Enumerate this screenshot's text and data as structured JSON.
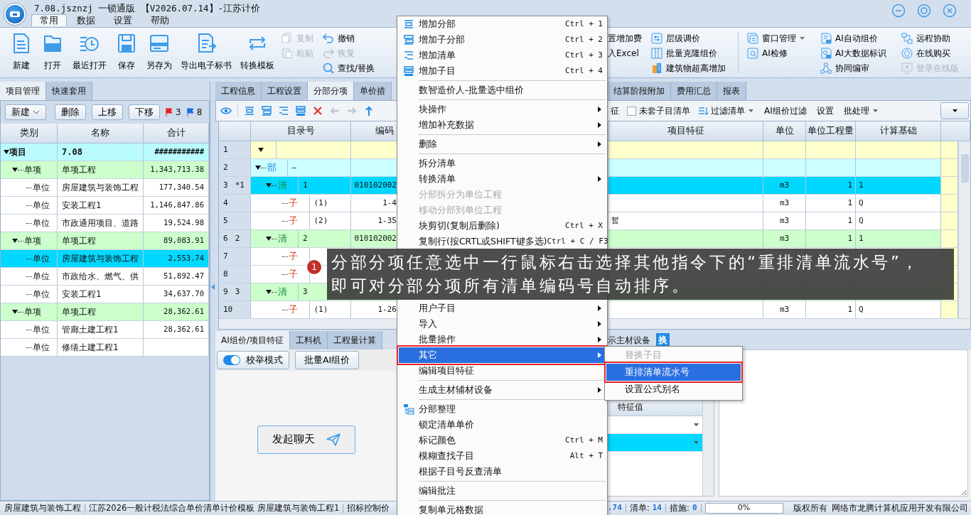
{
  "window": {
    "title": "7.08.jsznzj 一锁通版 【V2026.07.14】-江苏计价"
  },
  "ribbon_tabs": [
    {
      "label": "常用",
      "selected": true
    },
    {
      "label": "数据",
      "selected": false
    },
    {
      "label": "设置",
      "selected": false
    },
    {
      "label": "帮助",
      "selected": false
    }
  ],
  "ribbon_large": [
    "新建",
    "打开",
    "最近打开",
    "保存",
    "另存为",
    "导出电子标书",
    "转换模板"
  ],
  "ribbon_small_left": [
    [
      {
        "label": "复制",
        "kind": "button",
        "disabled": true
      },
      {
        "label": "粘贴",
        "kind": "button",
        "disabled": true
      }
    ],
    [
      {
        "label": "撤销",
        "kind": "button",
        "disabled": false
      },
      {
        "label": "恢复",
        "kind": "button",
        "disabled": true
      },
      {
        "label": "查找/替换",
        "kind": "button",
        "disabled": false
      }
    ]
  ],
  "ribbon_small_right": [
    [
      {
        "label": "置增加费",
        "kind": "plain",
        "disabled": false
      },
      {
        "label": "入Excel",
        "kind": "plain",
        "disabled": false
      }
    ],
    [
      {
        "label": "层级调价",
        "kind": "button",
        "disabled": false
      },
      {
        "label": "批量克隆组价",
        "kind": "button",
        "disabled": false
      },
      {
        "label": "建筑物超高增加",
        "kind": "button",
        "disabled": false
      }
    ],
    [
      {
        "label": "窗口管理",
        "kind": "menu",
        "disabled": false
      },
      {
        "label": "AI检修",
        "kind": "button",
        "disabled": false
      }
    ],
    [
      {
        "label": "AI自动组价",
        "kind": "button",
        "disabled": false
      },
      {
        "label": "AI大数据标识",
        "kind": "button",
        "disabled": false
      },
      {
        "label": "协同编审",
        "kind": "button",
        "disabled": false
      }
    ],
    [
      {
        "label": "远程协助",
        "kind": "button",
        "disabled": false
      },
      {
        "label": "在线购买",
        "kind": "button",
        "disabled": false
      },
      {
        "label": "登录在线版",
        "kind": "button",
        "disabled": true
      }
    ]
  ],
  "left_panel": {
    "tabs": [
      {
        "label": "项目管理",
        "selected": true
      },
      {
        "label": "快速套用",
        "selected": false
      }
    ],
    "toolbar": [
      {
        "label": "新建",
        "kind": "menu"
      },
      {
        "label": "删除",
        "kind": "button"
      },
      {
        "label": "上移",
        "kind": "button"
      },
      {
        "label": "下移",
        "kind": "button"
      }
    ],
    "flags": [
      {
        "count": "3",
        "color": "#e8201a"
      },
      {
        "count": "8",
        "color": "#1a6fe0"
      }
    ],
    "columns": [
      "类别",
      "名称",
      "合计"
    ],
    "tree": [
      {
        "type": "项目",
        "name": "7.08",
        "total": "###########",
        "kind": "project",
        "expanded": true,
        "selected": false,
        "children": [
          {
            "type": "单项",
            "name": "单项工程",
            "total": "1,343,713.38",
            "kind": "single",
            "expanded": true,
            "selected": false,
            "children": [
              {
                "type": "单位",
                "name": "房屋建筑与装饰工程",
                "total": "177,340.54",
                "kind": "unit",
                "selected": false
              },
              {
                "type": "单位",
                "name": "安装工程1",
                "total": "1,146,847.86",
                "kind": "unit",
                "selected": false
              },
              {
                "type": "单位",
                "name": "市政通用项目、道路",
                "total": "19,524.98",
                "kind": "unit",
                "selected": false
              }
            ]
          },
          {
            "type": "单项",
            "name": "单项工程",
            "total": "89,083.91",
            "kind": "single",
            "expanded": true,
            "selected": false,
            "children": [
              {
                "type": "单位",
                "name": "房屋建筑与装饰工程",
                "total": "2,553.74",
                "kind": "unit",
                "selected": true
              },
              {
                "type": "单位",
                "name": "市政给水、燃气、供",
                "total": "51,892.47",
                "kind": "unit",
                "selected": false
              },
              {
                "type": "单位",
                "name": "安装工程1",
                "total": "34,637.70",
                "kind": "unit",
                "selected": false
              }
            ]
          },
          {
            "type": "单项",
            "name": "单项工程",
            "total": "28,362.61",
            "kind": "single",
            "expanded": true,
            "selected": false,
            "children": [
              {
                "type": "单位",
                "name": "管廊土建工程1",
                "total": "28,362.61",
                "kind": "unit",
                "selected": false
              },
              {
                "type": "单位",
                "name": "修缮土建工程1",
                "kind": "unit",
                "selected": false
              }
            ]
          }
        ]
      }
    ]
  },
  "main_tabs_left": [
    {
      "label": "工程信息",
      "selected": false
    },
    {
      "label": "工程设置",
      "selected": false
    },
    {
      "label": "分部分项",
      "selected": true
    },
    {
      "label": "单价措",
      "selected": false
    }
  ],
  "main_tabs_right": [
    {
      "label": "结算阶段附加",
      "selected": false
    },
    {
      "label": "费用汇总",
      "selected": false
    },
    {
      "label": "报表",
      "selected": false
    }
  ],
  "grid_toolbar": {
    "tools": [
      {
        "disabled": false
      },
      {
        "disabled": false
      },
      {
        "disabled": false
      },
      {
        "disabled": false
      },
      {
        "disabled": false
      },
      {
        "disabled": false
      },
      {
        "disabled": true
      },
      {
        "disabled": true
      },
      {
        "disabled": false
      }
    ],
    "right": [
      {
        "kind": "text",
        "label": "征"
      },
      {
        "kind": "checkbox",
        "label": "未套子目清单",
        "checked": false
      },
      {
        "kind": "menu",
        "label": "过滤清单"
      },
      {
        "kind": "text",
        "label": "AI组价过滤"
      },
      {
        "kind": "text",
        "label": "设置"
      },
      {
        "kind": "menu",
        "label": "批处理"
      }
    ]
  },
  "grid": {
    "columns_left": [
      "目录号",
      "编码"
    ],
    "columns_right": [
      "项目特征",
      "单位",
      "单位工程量",
      "计算基础"
    ],
    "rows": [
      {
        "num": "1",
        "kind": "root",
        "expanded": true,
        "selected": false,
        "children": [
          {
            "num": "2",
            "kind": "division",
            "tag": "部",
            "catalog": "—",
            "expanded": true,
            "selected": false,
            "children": [
              {
                "num": "3",
                "seq": "*1",
                "kind": "item",
                "tag": "清",
                "catalog": "1",
                "code": "010102002",
                "unit": "m3",
                "qty": "1",
                "base": "1",
                "expanded": true,
                "selected": true,
                "children": [
                  {
                    "num": "4",
                    "kind": "sub",
                    "tag": "子",
                    "catalog": "(1)",
                    "code": "1-4",
                    "unit": "m3",
                    "qty": "1",
                    "base": "Q",
                    "selected": false
                  },
                  {
                    "num": "5",
                    "kind": "sub",
                    "tag": "子",
                    "catalog": "(2)",
                    "code": "1-35",
                    "feature": "暂",
                    "unit": "m3",
                    "qty": "1",
                    "base": "Q",
                    "selected": false
                  }
                ]
              },
              {
                "num": "6",
                "seq": "2",
                "kind": "item",
                "tag": "清",
                "catalog": "2",
                "code": "010102002",
                "unit": "m3",
                "qty": "1",
                "base": "1",
                "expanded": true,
                "selected": false,
                "children": [
                  {
                    "num": "7",
                    "kind": "sub",
                    "tag": "子",
                    "selected": false
                  },
                  {
                    "num": "8",
                    "kind": "sub",
                    "tag": "子",
                    "selected": false
                  }
                ]
              },
              {
                "num": "9",
                "seq": "3",
                "kind": "item",
                "tag": "清",
                "catalog": "3",
                "expanded": true,
                "selected": false,
                "children": [
                  {
                    "num": "10",
                    "kind": "sub",
                    "tag": "子",
                    "catalog": "(1)",
                    "code": "1-26",
                    "unit": "m3",
                    "qty": "1",
                    "base": "Q",
                    "selected": false
                  }
                ]
              }
            ]
          }
        ]
      }
    ]
  },
  "bottom_tabs": [
    {
      "label": "AI组价/项目特征",
      "selected": true
    },
    {
      "label": "工料机",
      "selected": false
    },
    {
      "label": "工程量计算",
      "selected": false
    }
  ],
  "bottom_right_tab": {
    "label": "示主材设备",
    "badge": "换"
  },
  "ai_panel": {
    "toggle": {
      "label": "校举模式",
      "on": true
    },
    "batch_button": "批量AI组价",
    "chat_button": "发起聊天"
  },
  "feature_table": {
    "column": "特征值",
    "rows": [
      {
        "selected": false
      },
      {
        "selected": true
      }
    ]
  },
  "context_menu": [
    {
      "kind": "icon-action",
      "label": "增加分部",
      "shortcut": "Ctrl + 1",
      "disabled": false,
      "selected": false
    },
    {
      "kind": "icon-action",
      "label": "增加子分部",
      "shortcut": "Ctrl + 2",
      "disabled": false,
      "selected": false
    },
    {
      "kind": "icon-action",
      "label": "增加清单",
      "shortcut": "Ctrl + 3",
      "disabled": false,
      "selected": false
    },
    {
      "kind": "icon-action",
      "label": "增加子目",
      "shortcut": "Ctrl + 4",
      "disabled": false,
      "selected": false
    },
    {
      "kind": "separator"
    },
    {
      "kind": "action",
      "label": "数智造价人-批量选中组价",
      "disabled": false,
      "selected": false
    },
    {
      "kind": "separator"
    },
    {
      "kind": "submenu",
      "label": "块操作",
      "disabled": false,
      "selected": false
    },
    {
      "kind": "submenu",
      "label": "增加补充数据",
      "disabled": false,
      "selected": false
    },
    {
      "kind": "separator"
    },
    {
      "kind": "submenu",
      "label": "删除",
      "disabled": false,
      "selected": false
    },
    {
      "kind": "separator"
    },
    {
      "kind": "action",
      "label": "拆分清单",
      "disabled": false,
      "selected": false
    },
    {
      "kind": "submenu",
      "label": "转换清单",
      "disabled": false,
      "selected": false
    },
    {
      "kind": "action",
      "label": "分部拆分为单位工程",
      "disabled": true,
      "selected": false
    },
    {
      "kind": "action",
      "label": "移动分部到单位工程",
      "disabled": true,
      "selected": false
    },
    {
      "kind": "action",
      "label": "块剪切(复制后删除)",
      "shortcut": "Ctrl + X",
      "disabled": false,
      "selected": false
    },
    {
      "kind": "action",
      "label": "复制行(按CRTL或SHIFT键多选)",
      "shortcut": "Ctrl + C / F3",
      "disabled": false,
      "selected": false
    },
    {
      "kind": "covered"
    },
    {
      "kind": "covered"
    },
    {
      "kind": "covered"
    },
    {
      "kind": "submenu",
      "label": "用户子目",
      "disabled": false,
      "selected": false
    },
    {
      "kind": "submenu",
      "label": "导入",
      "disabled": false,
      "selected": false
    },
    {
      "kind": "submenu",
      "label": "批量操作",
      "disabled": false,
      "selected": false
    },
    {
      "kind": "submenu",
      "label": "其它",
      "disabled": false,
      "selected": true
    },
    {
      "kind": "action",
      "label": "编辑项目特征",
      "disabled": false,
      "selected": false
    },
    {
      "kind": "separator"
    },
    {
      "kind": "submenu",
      "label": "生成主材辅材设备",
      "disabled": false,
      "selected": false
    },
    {
      "kind": "separator"
    },
    {
      "kind": "icon-action",
      "label": "分部整理",
      "disabled": false,
      "selected": false
    },
    {
      "kind": "action",
      "label": "锁定清单单价",
      "disabled": false,
      "selected": false
    },
    {
      "kind": "action",
      "label": "标记颜色",
      "shortcut": "Ctrl + M",
      "disabled": false,
      "selected": false
    },
    {
      "kind": "action",
      "label": "模糊查找子目",
      "shortcut": "Alt + T",
      "disabled": false,
      "selected": false
    },
    {
      "kind": "action",
      "label": "根据子目号反查清单",
      "disabled": false,
      "selected": false
    },
    {
      "kind": "separator"
    },
    {
      "kind": "action",
      "label": "编辑批注",
      "disabled": false,
      "selected": false
    },
    {
      "kind": "separator"
    },
    {
      "kind": "action",
      "label": "复制单元格数据",
      "disabled": false,
      "selected": false
    }
  ],
  "submenu": [
    {
      "label": "替换子目",
      "disabled": true,
      "selected": false
    },
    {
      "label": "重排清单流水号",
      "disabled": false,
      "selected": true
    },
    {
      "label": "设置公式别名",
      "disabled": false,
      "selected": false
    }
  ],
  "callout": {
    "number": "1",
    "text": "分部分项任意选中一行鼠标右击选择其他指令下的“重排清单流水号”，即可对分部分项所有清单编码号自动排序。"
  },
  "status_bar": {
    "left": [
      "房屋建筑与装饰工程",
      "江苏2026一般计税法综合单价清单计价模板 房屋建筑与装饰工程1",
      "招标控制价"
    ],
    "amount": ".74",
    "counts": [
      {
        "label": "清单:",
        "value": "14"
      },
      {
        "label": "措施:",
        "value": "0"
      }
    ],
    "progress": {
      "level": 0,
      "text": "0%"
    },
    "copyright": "版权所有",
    "company": "网络市龙腾计算机应用开发有限公司"
  }
}
